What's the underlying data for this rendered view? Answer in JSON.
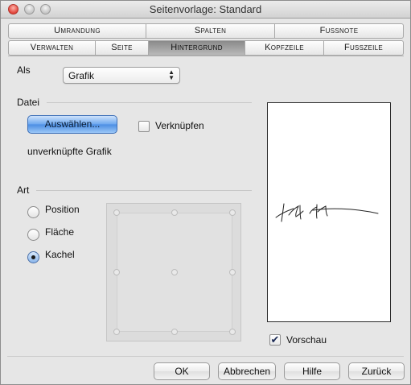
{
  "window": {
    "title": "Seitenvorlage: Standard"
  },
  "tabs": {
    "row1": [
      {
        "label": "Umrandung"
      },
      {
        "label": "Spalten"
      },
      {
        "label": "Fussnote"
      }
    ],
    "row2": [
      {
        "label": "Verwalten"
      },
      {
        "label": "Seite"
      },
      {
        "label": "Hintergrund",
        "active": true
      },
      {
        "label": "Kopfzeile"
      },
      {
        "label": "Fusszeile"
      }
    ]
  },
  "als": {
    "label": "Als",
    "value": "Grafik"
  },
  "datei": {
    "section_label": "Datei",
    "select_button": "Auswählen...",
    "link_checkbox": {
      "label": "Verknüpfen",
      "checked": false
    },
    "status": "unverknüpfte Grafik"
  },
  "art": {
    "section_label": "Art",
    "options": [
      {
        "label": "Position",
        "selected": false
      },
      {
        "label": "Fläche",
        "selected": false
      },
      {
        "label": "Kachel",
        "selected": true
      }
    ]
  },
  "preview": {
    "checkbox_label": "Vorschau",
    "checked": true
  },
  "buttons": {
    "ok": "OK",
    "cancel": "Abbrechen",
    "help": "Hilfe",
    "reset": "Zurück"
  },
  "colors": {
    "primary_button": "#6aa6ef",
    "active_tab": "#8a8a8a"
  }
}
